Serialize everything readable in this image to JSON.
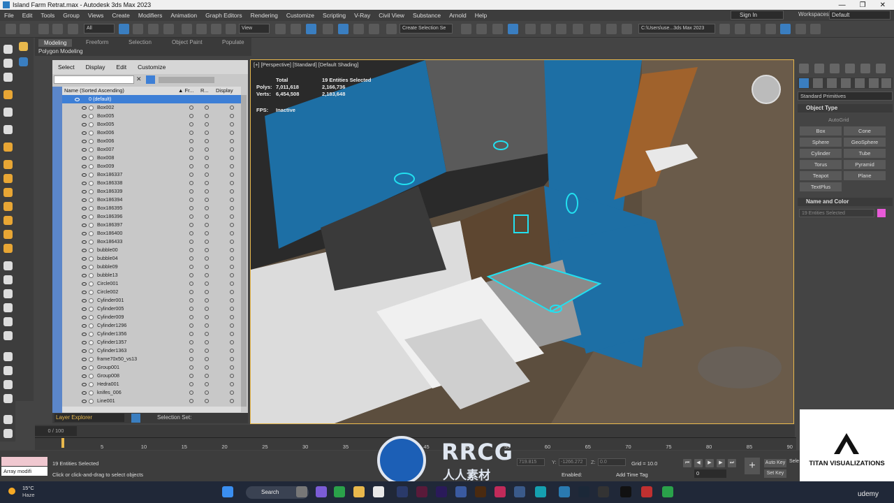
{
  "window": {
    "title": "Island Farm Retrat.max - Autodesk 3ds Max 2023"
  },
  "menu": [
    "File",
    "Edit",
    "Tools",
    "Group",
    "Views",
    "Create",
    "Modifiers",
    "Animation",
    "Graph Editors",
    "Rendering",
    "Customize",
    "Scripting",
    "V-Ray",
    "Civil View",
    "Substance",
    "Arnold",
    "Help"
  ],
  "signin": "Sign In",
  "workspaces": {
    "label": "Workspaces:",
    "value": "Default"
  },
  "toolbar": {
    "filter": "All",
    "refcoord": "View",
    "selection_set": "Create Selection Se",
    "path": "C:\\Users\\use...3ds Max 2023"
  },
  "ribbon": {
    "tabs": [
      "Modeling",
      "Freeform",
      "Selection",
      "Object Paint",
      "Populate"
    ],
    "sub": "Polygon Modeling"
  },
  "scene_explorer": {
    "menu": [
      "Select",
      "Display",
      "Edit",
      "Customize"
    ],
    "columns": [
      "Name (Sorted Ascending)",
      "▲ Fr...",
      "R...",
      "Display a..."
    ],
    "root": "0 (default)",
    "items": [
      "Box002",
      "Box005",
      "Box005",
      "Box006",
      "Box006",
      "Box007",
      "Box008",
      "Box009",
      "Box186337",
      "Box186338",
      "Box186339",
      "Box186394",
      "Box186395",
      "Box186396",
      "Box186397",
      "Box186400",
      "Box186433",
      "bubble00",
      "bubble04",
      "bubble09",
      "bubble13",
      "Circle001",
      "Circle002",
      "Cylinder001",
      "Cylinder005",
      "Cylinder009",
      "Cylinder1296",
      "Cylinder1356",
      "Cylinder1357",
      "Cylinder1363",
      "frame70x50_vs13",
      "Group001",
      "Group008",
      "Hedra001",
      "knifes_006",
      "Line001"
    ],
    "layer_explorer": "Layer Explorer",
    "selection_set_label": "Selection Set:"
  },
  "viewport": {
    "label": "[+] [Perspective] [Standard] [Default Shading]",
    "stats": {
      "total": "Total",
      "selected": "19 Entities Selected",
      "polys_label": "Polys:",
      "polys_total": "7,011,618",
      "polys_sel": "2,166,736",
      "verts_label": "Verts:",
      "verts_total": "6,454,508",
      "verts_sel": "2,183,648",
      "fps_label": "FPS:",
      "fps_value": "Inactive"
    }
  },
  "command_panel": {
    "dropdown": "Standard Primitives",
    "object_type": "Object Type",
    "autogrid": "AutoGrid",
    "buttons": [
      "Box",
      "Cone",
      "Sphere",
      "GeoSphere",
      "Cylinder",
      "Tube",
      "Torus",
      "Pyramid",
      "Teapot",
      "Plane",
      "TextPlus"
    ],
    "name_color": "Name and Color",
    "name_value": "19 Entities Selected",
    "color": "#e85ad8"
  },
  "timeline": {
    "frame": "0 / 100",
    "ticks": [
      "5",
      "10",
      "15",
      "20",
      "25",
      "30",
      "35",
      "40",
      "45",
      "50",
      "55",
      "60",
      "65",
      "70",
      "75",
      "80",
      "85",
      "90"
    ]
  },
  "status": {
    "selected": "19 Entities Selected",
    "hint": "Click or click-and-drag to select objects",
    "array": "Array modifi",
    "x_value": "719.815",
    "y_label": "Y:",
    "y_value": "-1266.272",
    "z_label": "Z:",
    "z_value": "0.0",
    "grid": "Grid = 10.0",
    "enabled": "Enabled:",
    "add_time_tag": "Add Time Tag",
    "auto_key": "Auto Key",
    "set_key": "Set Key",
    "sel": "Sele",
    "frame_input": "0"
  },
  "taskbar": {
    "temp": "15°C",
    "weather": "Haze",
    "search": "Search"
  },
  "logo": {
    "text": "TITAN VISUALIZATIONS"
  },
  "watermark": {
    "main": "RRCG",
    "sub": "人人素材"
  },
  "udemy": "udemy"
}
